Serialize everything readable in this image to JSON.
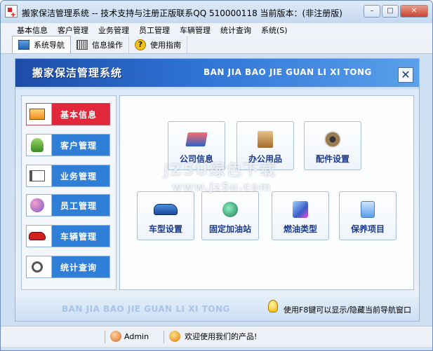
{
  "window": {
    "title": "搬家保洁管理系统 -- 技术支持与注册正版联系QQ 510000118   当前版本：(非注册版)",
    "min_label": "–",
    "max_label": "□",
    "close_label": "✕"
  },
  "menu": {
    "items": [
      {
        "label": "基本信息"
      },
      {
        "label": "客户管理"
      },
      {
        "label": "业务管理"
      },
      {
        "label": "员工管理"
      },
      {
        "label": "车辆管理"
      },
      {
        "label": "统计查询"
      },
      {
        "label": "系统(S)"
      }
    ]
  },
  "toolbar": {
    "tabs": [
      {
        "label": "系统导航",
        "icon": "navigation-icon",
        "active": true
      },
      {
        "label": "信息操作",
        "icon": "info-operation-icon",
        "active": false
      },
      {
        "label": "使用指南",
        "icon": "help-icon",
        "active": false
      }
    ]
  },
  "banner": {
    "title": "搬家保洁管理系统",
    "pinyin": "BAN JIA BAO JIE GUAN LI XI TONG",
    "close_label": "✕"
  },
  "sidebar": {
    "items": [
      {
        "label": "基本信息",
        "icon": "basic-info-icon",
        "active": true
      },
      {
        "label": "客户管理",
        "icon": "customer-icon",
        "active": false
      },
      {
        "label": "业务管理",
        "icon": "business-icon",
        "active": false
      },
      {
        "label": "员工管理",
        "icon": "staff-icon",
        "active": false
      },
      {
        "label": "车辆管理",
        "icon": "vehicle-icon",
        "active": false
      },
      {
        "label": "统计查询",
        "icon": "statistics-icon",
        "active": false
      }
    ]
  },
  "tiles": [
    {
      "label": "公司信息",
      "icon": "company-info-icon"
    },
    {
      "label": "办公用品",
      "icon": "office-supplies-icon"
    },
    {
      "label": "配件设置",
      "icon": "parts-settings-icon"
    },
    {
      "label": "车型设置",
      "icon": "car-model-icon"
    },
    {
      "label": "固定加油站",
      "icon": "gas-station-icon"
    },
    {
      "label": "燃油类型",
      "icon": "fuel-type-icon"
    },
    {
      "label": "保养项目",
      "icon": "maintenance-icon"
    }
  ],
  "bottom": {
    "pinyin": "BAN JIA BAO JIE GUAN LI XI TONG",
    "hint": "使用F8键可以显示/隐藏当前导航窗口"
  },
  "statusbar": {
    "user": "Admin",
    "message": "欢迎使用我们的产品!"
  },
  "watermark": {
    "line1": "JZ5U绿色下载",
    "line2": "www.jz5u.com"
  }
}
